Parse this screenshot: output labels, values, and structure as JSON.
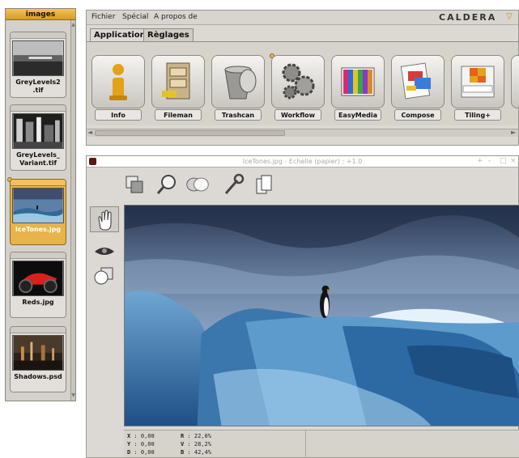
{
  "colors": {
    "accent": "#e8b34a",
    "panel": "#dcd9d4",
    "brand": "#333333"
  },
  "left_panel": {
    "header": "images",
    "items": [
      {
        "name": "GreyLevels2.tif",
        "caption_line1": "GreyLevels2",
        "caption_line2": ".tif",
        "selected": false
      },
      {
        "name": "GreyLevels_Variant.tif",
        "caption_line1": "GreyLevels_",
        "caption_line2": "Variant.tif",
        "selected": false
      },
      {
        "name": "IceTones.jpg",
        "caption_line1": "IceTones.jpg",
        "caption_line2": "",
        "selected": true
      },
      {
        "name": "Reds.jpg",
        "caption_line1": "Reds.jpg",
        "caption_line2": "",
        "selected": false
      },
      {
        "name": "Shadows.psd",
        "caption_line1": "Shadows.psd",
        "caption_line2": "",
        "selected": false
      }
    ]
  },
  "menu": {
    "items": [
      "Fichier",
      "Spécial",
      "A propos de"
    ],
    "brand": "CALDERA"
  },
  "tabs": [
    {
      "label": "Applications",
      "active": true
    },
    {
      "label": "Règlages",
      "active": false
    }
  ],
  "apps": [
    {
      "label": "Info",
      "icon": "info-icon"
    },
    {
      "label": "Fileman",
      "icon": "file-cabinet-icon"
    },
    {
      "label": "Trashcan",
      "icon": "trashcan-icon"
    },
    {
      "label": "Workflow",
      "icon": "gears-icon"
    },
    {
      "label": "EasyMedia",
      "icon": "color-chart-icon"
    },
    {
      "label": "Compose",
      "icon": "compose-icon"
    },
    {
      "label": "Tiling+",
      "icon": "tiling-icon"
    }
  ],
  "viewer": {
    "title": "IceTones.jpg - Echelle (papier) : +1.0",
    "window_buttons": [
      "+",
      "-",
      "□",
      "×"
    ],
    "toolbar_icons": [
      "crop-icon",
      "magnifier-icon",
      "overlay-icon",
      "wrench-icon",
      "pages-icon"
    ],
    "side_tools": [
      "hand-icon",
      "eye-icon",
      "shapes-icon"
    ],
    "status": {
      "x": {
        "label": "X",
        "value": "0,00"
      },
      "y": {
        "label": "Y",
        "value": "0,00"
      },
      "d": {
        "label": "D",
        "value": "0,00"
      },
      "r": {
        "label": "R",
        "value": "22,0%"
      },
      "v": {
        "label": "V",
        "value": "28,2%"
      },
      "b": {
        "label": "B",
        "value": "42,4%"
      }
    }
  }
}
